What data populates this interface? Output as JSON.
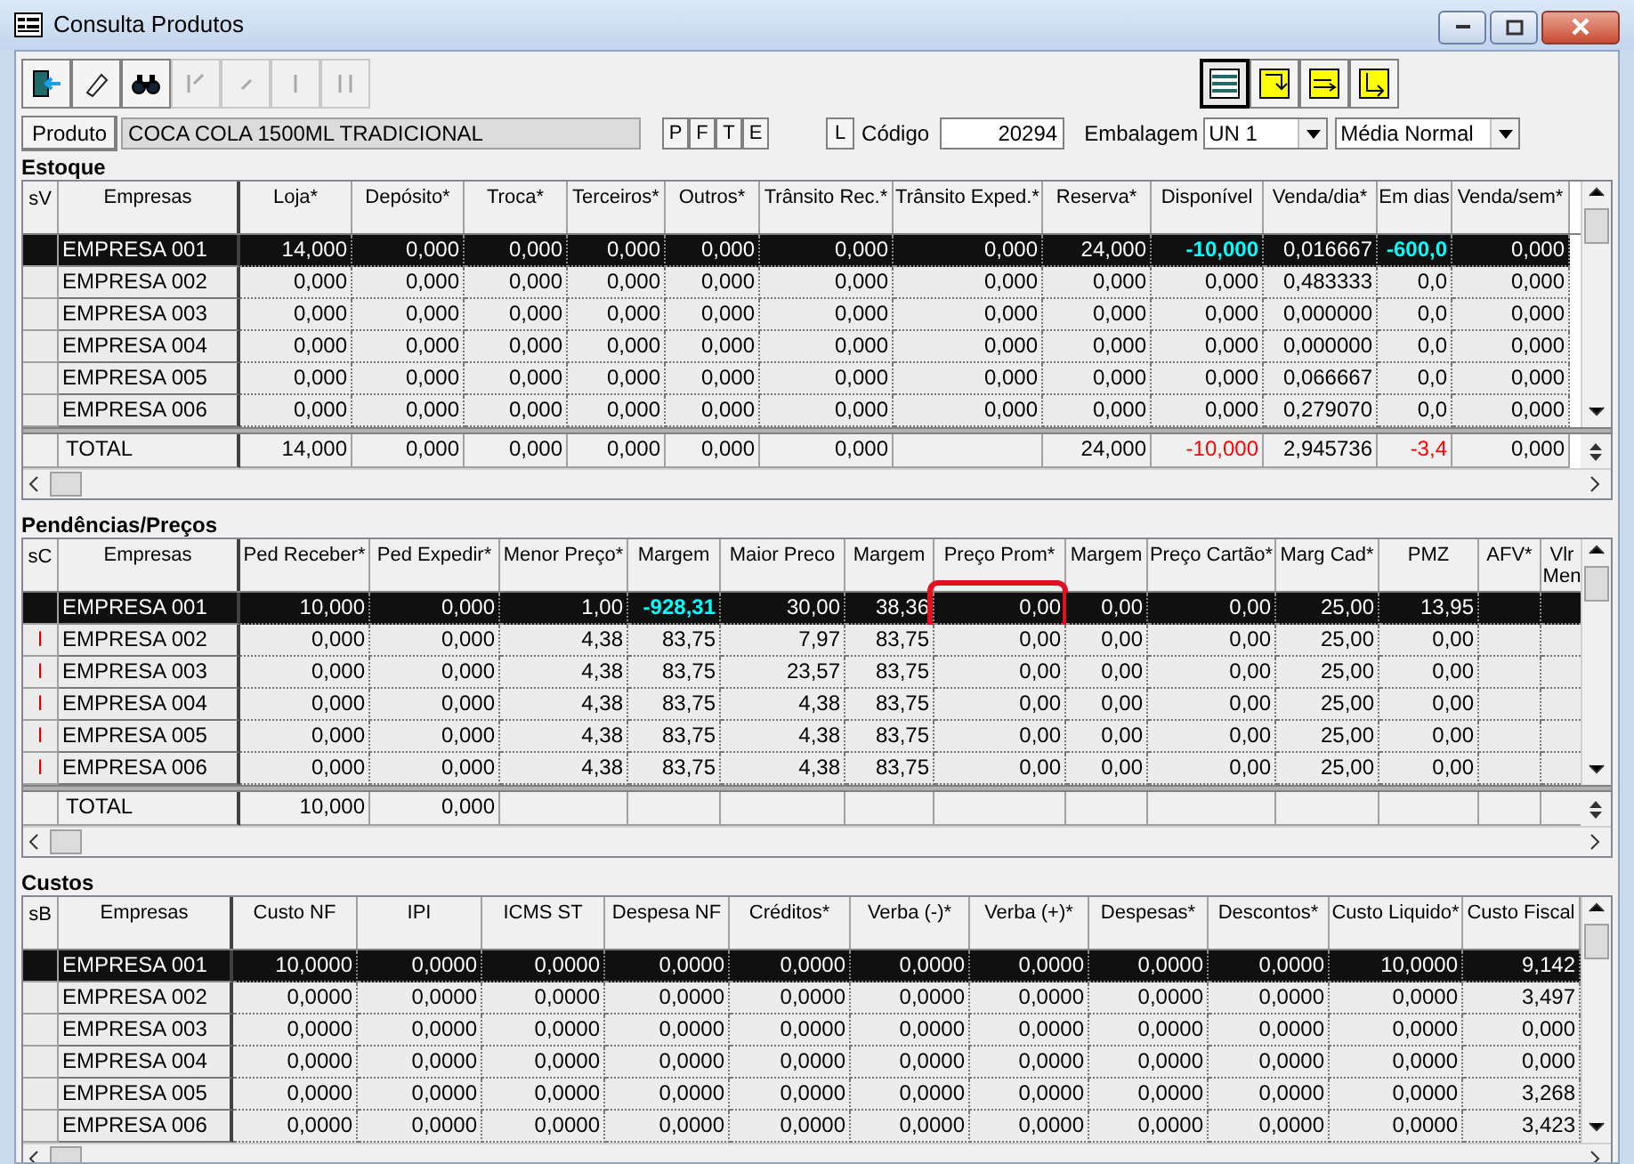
{
  "window": {
    "title": "Consulta Produtos"
  },
  "toolbar": [
    {
      "kind": "exit",
      "disabled": false
    },
    {
      "kind": "erase",
      "disabled": false
    },
    {
      "kind": "search",
      "disabled": false
    },
    {
      "kind": "first",
      "disabled": true
    },
    {
      "kind": "prev",
      "disabled": true
    },
    {
      "kind": "next",
      "disabled": true
    },
    {
      "kind": "last",
      "disabled": true
    }
  ],
  "view_buttons": [
    {
      "kind": "list",
      "selected": true
    },
    {
      "kind": "in",
      "selected": false
    },
    {
      "kind": "swap",
      "selected": false
    },
    {
      "kind": "out",
      "selected": false
    }
  ],
  "product": {
    "button": "Produto",
    "value": "COCA COLA 1500ML TRADICIONAL",
    "flags": [
      "P",
      "F",
      "T",
      "E"
    ],
    "l_button": "L",
    "code_label": "Código",
    "code": "20294",
    "pack_label": "Embalagem",
    "pack": "UN  1",
    "average": "Média Normal"
  },
  "grids": [
    {
      "title": "Estoque",
      "marker_header": "sV",
      "columns": [
        "Empresas",
        "Loja*",
        "Depósito*",
        "Troca*",
        "Terceiros*",
        "Outros*",
        "Trânsito Rec.*",
        "Trânsito Exped.*",
        "Reserva*",
        "Disponível",
        "Venda/dia*",
        "Em dias",
        "Venda/sem*"
      ],
      "rows": [
        {
          "selected": true,
          "cells": [
            "EMPRESA 001",
            "14,000",
            "0,000",
            "0,000",
            "0,000",
            "0,000",
            "0,000",
            "0,000",
            "24,000",
            {
              "text": "-10,000",
              "color": "#00ffff"
            },
            "0,016667",
            {
              "text": "-600,0",
              "color": "#00ffff"
            },
            "0,000"
          ]
        },
        {
          "selected": false,
          "cells": [
            "EMPRESA 002",
            "0,000",
            "0,000",
            "0,000",
            "0,000",
            "0,000",
            "0,000",
            "0,000",
            "0,000",
            "0,000",
            "0,483333",
            "0,0",
            "0,000"
          ]
        },
        {
          "selected": false,
          "cells": [
            "EMPRESA 003",
            "0,000",
            "0,000",
            "0,000",
            "0,000",
            "0,000",
            "0,000",
            "0,000",
            "0,000",
            "0,000",
            "0,000000",
            "0,0",
            "0,000"
          ]
        },
        {
          "selected": false,
          "cells": [
            "EMPRESA 004",
            "0,000",
            "0,000",
            "0,000",
            "0,000",
            "0,000",
            "0,000",
            "0,000",
            "0,000",
            "0,000",
            "0,000000",
            "0,0",
            "0,000"
          ]
        },
        {
          "selected": false,
          "cells": [
            "EMPRESA 005",
            "0,000",
            "0,000",
            "0,000",
            "0,000",
            "0,000",
            "0,000",
            "0,000",
            "0,000",
            "0,000",
            "0,066667",
            "0,0",
            "0,000"
          ]
        },
        {
          "selected": false,
          "cells": [
            "EMPRESA 006",
            "0,000",
            "0,000",
            "0,000",
            "0,000",
            "0,000",
            "0,000",
            "0,000",
            "0,000",
            "0,000",
            "0,279070",
            "0,0",
            "0,000"
          ]
        }
      ],
      "total": [
        "TOTAL",
        "14,000",
        "0,000",
        "0,000",
        "0,000",
        "0,000",
        "0,000",
        {
          "text": "24,000",
          "gap_before": true
        },
        {
          "text": "-10,000",
          "color": "#ff0000"
        },
        "2,945736",
        {
          "text": "-3,4",
          "color": "#ff0000"
        },
        "0,000"
      ]
    },
    {
      "title": "Pendências/Preços",
      "marker_header": "sC",
      "columns": [
        "Empresas",
        "Ped Receber*",
        "Ped Expedir*",
        "Menor Preço*",
        "Margem",
        "Maior Preco",
        "Margem",
        "Preço Prom*",
        "Margem",
        "Preço Cartão*",
        "Marg Cad*",
        "PMZ",
        "AFV*",
        "Vlr Men"
      ],
      "rows": [
        {
          "selected": true,
          "cells": [
            "EMPRESA 001",
            "10,000",
            "0,000",
            "1,00",
            {
              "text": "-928,31",
              "color": "#00ffff"
            },
            "30,00",
            "38,36",
            {
              "text": "0,00",
              "outlined": true
            },
            "0,00",
            "0,00",
            "25,00",
            "13,95"
          ]
        },
        {
          "selected": false,
          "marker": "I",
          "cells": [
            "EMPRESA 002",
            "0,000",
            "0,000",
            "4,38",
            "83,75",
            "7,97",
            "83,75",
            "0,00",
            "0,00",
            "0,00",
            "25,00",
            "0,00"
          ]
        },
        {
          "selected": false,
          "marker": "I",
          "cells": [
            "EMPRESA 003",
            "0,000",
            "0,000",
            "4,38",
            "83,75",
            "23,57",
            "83,75",
            "0,00",
            "0,00",
            "0,00",
            "25,00",
            "0,00"
          ]
        },
        {
          "selected": false,
          "marker": "I",
          "cells": [
            "EMPRESA 004",
            "0,000",
            "0,000",
            "4,38",
            "83,75",
            "4,38",
            "83,75",
            "0,00",
            "0,00",
            "0,00",
            "25,00",
            "0,00"
          ]
        },
        {
          "selected": false,
          "marker": "I",
          "cells": [
            "EMPRESA 005",
            "0,000",
            "0,000",
            "4,38",
            "83,75",
            "4,38",
            "83,75",
            "0,00",
            "0,00",
            "0,00",
            "25,00",
            "0,00"
          ]
        },
        {
          "selected": false,
          "marker": "I",
          "cells": [
            "EMPRESA 006",
            "0,000",
            "0,000",
            "4,38",
            "83,75",
            "4,38",
            "83,75",
            "0,00",
            "0,00",
            "0,00",
            "25,00",
            "0,00"
          ]
        }
      ],
      "total": [
        "TOTAL",
        "10,000",
        "0,000"
      ]
    },
    {
      "title": "Custos",
      "marker_header": "sB",
      "columns": [
        "Empresas",
        "Custo NF",
        "IPI",
        "ICMS ST",
        "Despesa NF",
        "Créditos*",
        "Verba (-)*",
        "Verba (+)*",
        "Despesas*",
        "Descontos*",
        "Custo Liquido*",
        "Custo Fiscal"
      ],
      "rows": [
        {
          "selected": true,
          "cells": [
            "EMPRESA 001",
            "10,0000",
            "0,0000",
            "0,0000",
            "0,0000",
            "0,0000",
            "0,0000",
            "0,0000",
            "0,0000",
            "0,0000",
            "10,0000",
            "9,142"
          ]
        },
        {
          "selected": false,
          "cells": [
            "EMPRESA 002",
            "0,0000",
            "0,0000",
            "0,0000",
            "0,0000",
            "0,0000",
            "0,0000",
            "0,0000",
            "0,0000",
            "0,0000",
            "0,0000",
            "3,497"
          ]
        },
        {
          "selected": false,
          "cells": [
            "EMPRESA 003",
            "0,0000",
            "0,0000",
            "0,0000",
            "0,0000",
            "0,0000",
            "0,0000",
            "0,0000",
            "0,0000",
            "0,0000",
            "0,0000",
            "0,000"
          ]
        },
        {
          "selected": false,
          "cells": [
            "EMPRESA 004",
            "0,0000",
            "0,0000",
            "0,0000",
            "0,0000",
            "0,0000",
            "0,0000",
            "0,0000",
            "0,0000",
            "0,0000",
            "0,0000",
            "0,000"
          ]
        },
        {
          "selected": false,
          "cells": [
            "EMPRESA 005",
            "0,0000",
            "0,0000",
            "0,0000",
            "0,0000",
            "0,0000",
            "0,0000",
            "0,0000",
            "0,0000",
            "0,0000",
            "0,0000",
            "3,268"
          ]
        },
        {
          "selected": false,
          "cells": [
            "EMPRESA 006",
            "0,0000",
            "0,0000",
            "0,0000",
            "0,0000",
            "0,0000",
            "0,0000",
            "0,0000",
            "0,0000",
            "0,0000",
            "0,0000",
            "3,423"
          ]
        }
      ]
    }
  ]
}
